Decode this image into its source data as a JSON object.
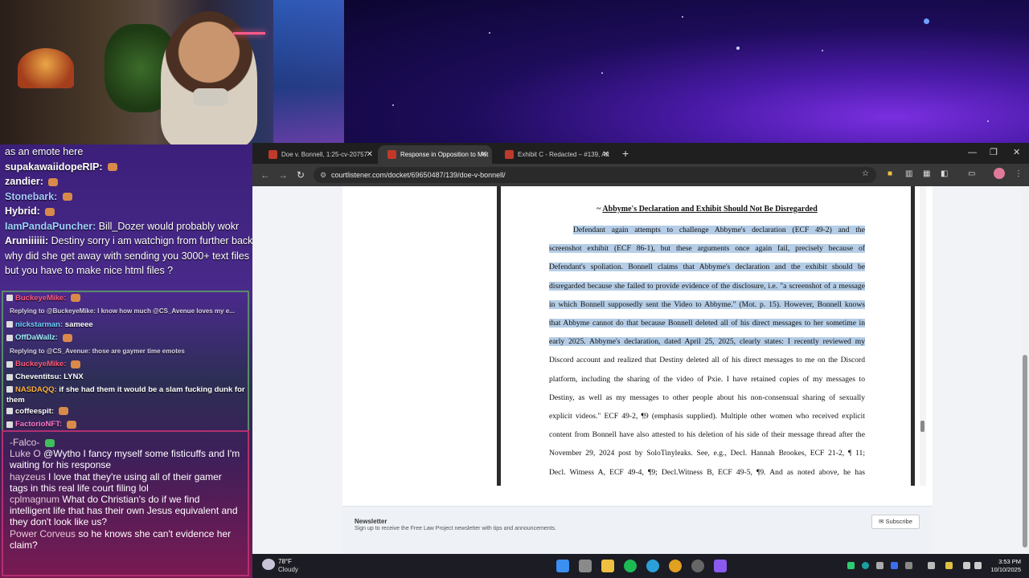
{
  "chat_top": [
    {
      "user": "",
      "text": "as an emote here",
      "ucolor": "#ffffff"
    },
    {
      "user": "supakawaiidopeRIP:",
      "text": "",
      "ucolor": "#ffffff"
    },
    {
      "user": "zandier:",
      "text": "",
      "ucolor": "#ffffff"
    },
    {
      "user": "Stonebark:",
      "text": "",
      "ucolor": "#a8c8ff"
    },
    {
      "user": "Hybrid:",
      "text": "",
      "ucolor": "#ffffff"
    },
    {
      "user": "IamPandaPuncher:",
      "text": "Bill_Dozer would probably wokr",
      "ucolor": "#9fd0ff"
    },
    {
      "user": "Aruniiiiii:",
      "text": "Destiny sorry i am watchign from further back,",
      "ucolor": "#ffffff"
    },
    {
      "user": "",
      "text": "why did she get away with sending you 3000+ text files",
      "ucolor": "#ffffff"
    },
    {
      "user": "",
      "text": "but you have to make nice html files ?",
      "ucolor": "#ffffff"
    }
  ],
  "chat_mid": [
    {
      "user": "BuckeyeMike:",
      "text": "",
      "ucolor": "#ff5a7a",
      "reply": ""
    },
    {
      "user": "",
      "text": "",
      "ucolor": "#ffffff",
      "reply": "Replying to @BuckeyeMike: I know how much @CS_Avenue loves my e..."
    },
    {
      "user": "nickstarman:",
      "text": "sameee",
      "ucolor": "#6fd0ff",
      "reply": ""
    },
    {
      "user": "OffDaWallz:",
      "text": "",
      "ucolor": "#9ef0ff",
      "reply": ""
    },
    {
      "user": "",
      "text": "",
      "ucolor": "#ffffff",
      "reply": "Replying to @CS_Avenue: those are gaymer time emotes"
    },
    {
      "user": "BuckeyeMike:",
      "text": "",
      "ucolor": "#ff5a7a",
      "reply": ""
    },
    {
      "user": "Cheventitsu:",
      "text": "LYNX",
      "ucolor": "#ffffff",
      "reply": ""
    },
    {
      "user": "NASDAQQ:",
      "text": "if she had them it would be a slam fucking dunk for them",
      "ucolor": "#ffb040",
      "reply": ""
    },
    {
      "user": "coffeespit:",
      "text": "",
      "ucolor": "#ffffff",
      "reply": ""
    },
    {
      "user": "FactorioNFT:",
      "text": "",
      "ucolor": "#ff7ad0",
      "reply": ""
    }
  ],
  "chat_bottom": [
    {
      "user": "-Falco-",
      "text": ""
    },
    {
      "user": "Luke O",
      "text": "@Wytho I fancy myself some fisticuffs and I'm waiting for his response"
    },
    {
      "user": "hayzeus",
      "text": "I love that they're using all of their gamer tags in this real life court filing lol"
    },
    {
      "user": "cplmagnum",
      "text": "What do Christian's do if we find intelligent life that has their own Jesus equivalent and they don't look like us?"
    },
    {
      "user": "Power Corveus",
      "text": "so he knows she can't evidence her claim?"
    }
  ],
  "browser": {
    "tabs": [
      {
        "label": "Doe v. Bonnell, 1:25-cv-20757"
      },
      {
        "label": "Response in Opposition to Mot"
      },
      {
        "label": "Exhibit C - Redacted – #139, Att"
      }
    ],
    "url": "courtlistener.com/docket/69650487/139/doe-v-bonnell/"
  },
  "document": {
    "heading_prefix": "~",
    "heading": "Abbyme's Declaration and Exhibit Should Not Be Disregarded",
    "lines": [
      "Defendant again attempts to challenge Abbyme's declaration (ECF 49-2) and the",
      "screenshot exhibit (ECF 86-1), but these arguments once again fail, precisely because of",
      "Defendant's spoliation. Bonnell claims that Abbyme's declaration and the exhibit should be",
      "disregarded because she failed to provide evidence of the disclosure, i.e. \"a screenshot of a message",
      "in which Bonnell supposedly sent the Video to Abbyme.\" (Mot. p. 15). However, Bonnell knows",
      "that Abbyme cannot do that because Bonnell deleted all of his direct messages to her sometime in",
      "early 2025. Abbyme's declaration, dated April 25, 2025, clearly states: I recently reviewed my",
      "Discord account and realized that Destiny deleted all of his direct messages to me on the Discord",
      "platform, including the sharing of the video of Pxie. I have retained copies of my messages to",
      "Destiny, as well as my messages to other people about his non-consensual sharing of sexually",
      "explicit videos.\" ECF 49-2, ¶9 (emphasis supplied). Multiple other women who received explicit",
      "content from Bonnell have also attested to his deletion of his side of their message thread after the",
      "November 29, 2024 post by SoloTinyleaks. See, e.g., Decl. Hannah Brookes, ECF 21-2, ¶ 11;",
      "Decl. Witness A, ECF 49-4, ¶9; Decl.Witness B, ECF 49-5, ¶9. And as noted above, he has"
    ]
  },
  "newsletter": {
    "title": "Newsletter",
    "subtitle": "Sign up to receive the Free Law Project newsletter with tips and announcements.",
    "button": "Subscribe"
  },
  "taskbar": {
    "temp": "78°F",
    "condition": "Cloudy",
    "time": "3:53 PM",
    "date": "10/10/2025"
  }
}
